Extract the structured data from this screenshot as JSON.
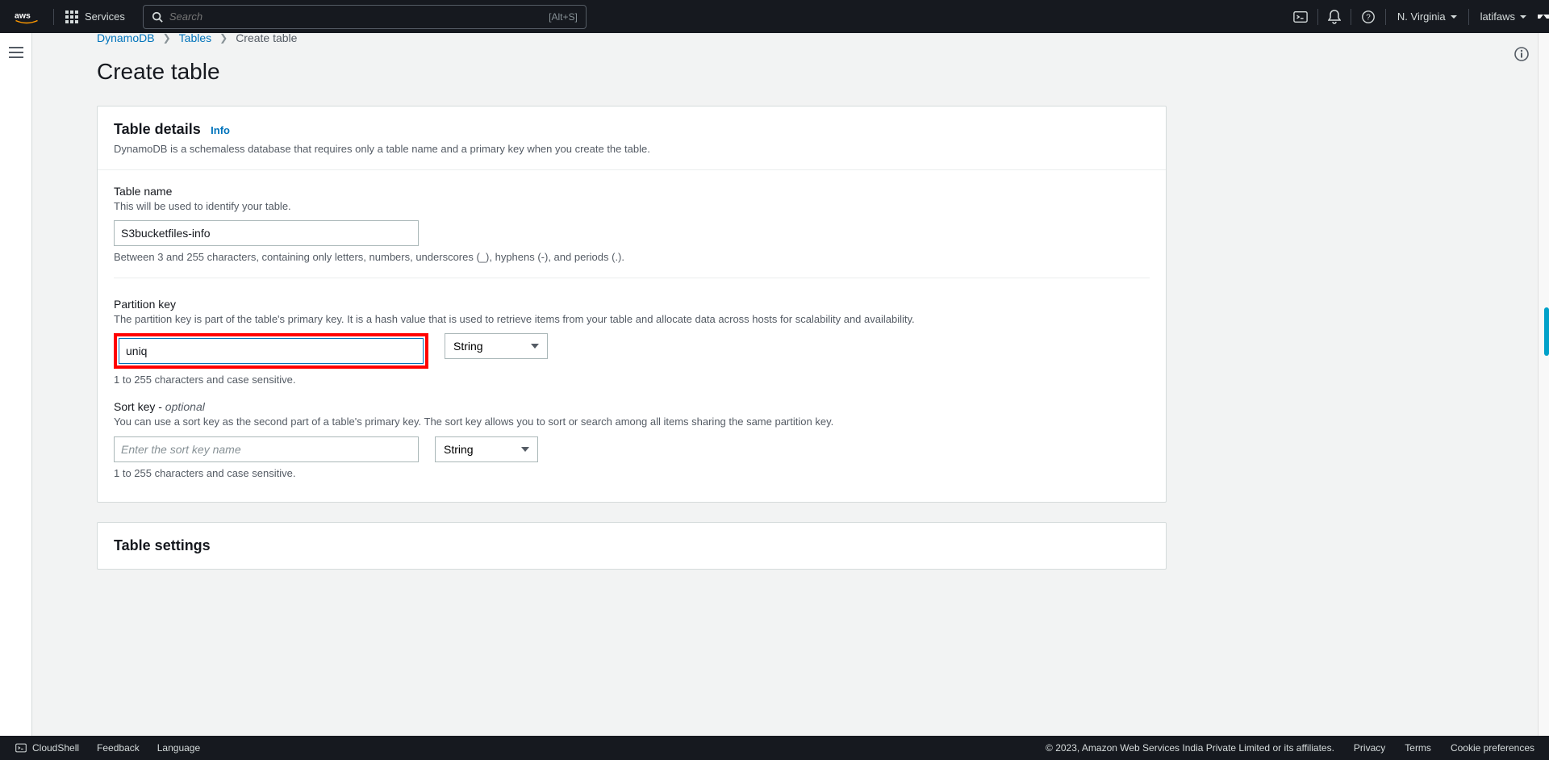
{
  "nav": {
    "services": "Services",
    "search_placeholder": "Search",
    "search_shortcut": "[Alt+S]",
    "region": "N. Virginia",
    "user": "latifaws"
  },
  "breadcrumbs": {
    "root": "DynamoDB",
    "tables": "Tables",
    "current": "Create table"
  },
  "page": {
    "title": "Create table"
  },
  "table_details": {
    "heading": "Table details",
    "info": "Info",
    "sub": "DynamoDB is a schemaless database that requires only a table name and a primary key when you create the table."
  },
  "table_name": {
    "label": "Table name",
    "desc": "This will be used to identify your table.",
    "value": "S3bucketfiles-info",
    "help": "Between 3 and 255 characters, containing only letters, numbers, underscores (_), hyphens (-), and periods (.)."
  },
  "partition_key": {
    "label": "Partition key",
    "desc": "The partition key is part of the table's primary key. It is a hash value that is used to retrieve items from your table and allocate data across hosts for scalability and availability.",
    "value": "uniq",
    "type": "String",
    "help": "1 to 255 characters and case sensitive."
  },
  "sort_key": {
    "label_prefix": "Sort key - ",
    "optional": "optional",
    "desc": "You can use a sort key as the second part of a table's primary key. The sort key allows you to sort or search among all items sharing the same partition key.",
    "placeholder": "Enter the sort key name",
    "type": "String",
    "help": "1 to 255 characters and case sensitive."
  },
  "table_settings": {
    "heading": "Table settings"
  },
  "footer": {
    "cloudshell": "CloudShell",
    "feedback": "Feedback",
    "language": "Language",
    "copyright": "© 2023, Amazon Web Services India Private Limited or its affiliates.",
    "privacy": "Privacy",
    "terms": "Terms",
    "cookies": "Cookie preferences"
  }
}
